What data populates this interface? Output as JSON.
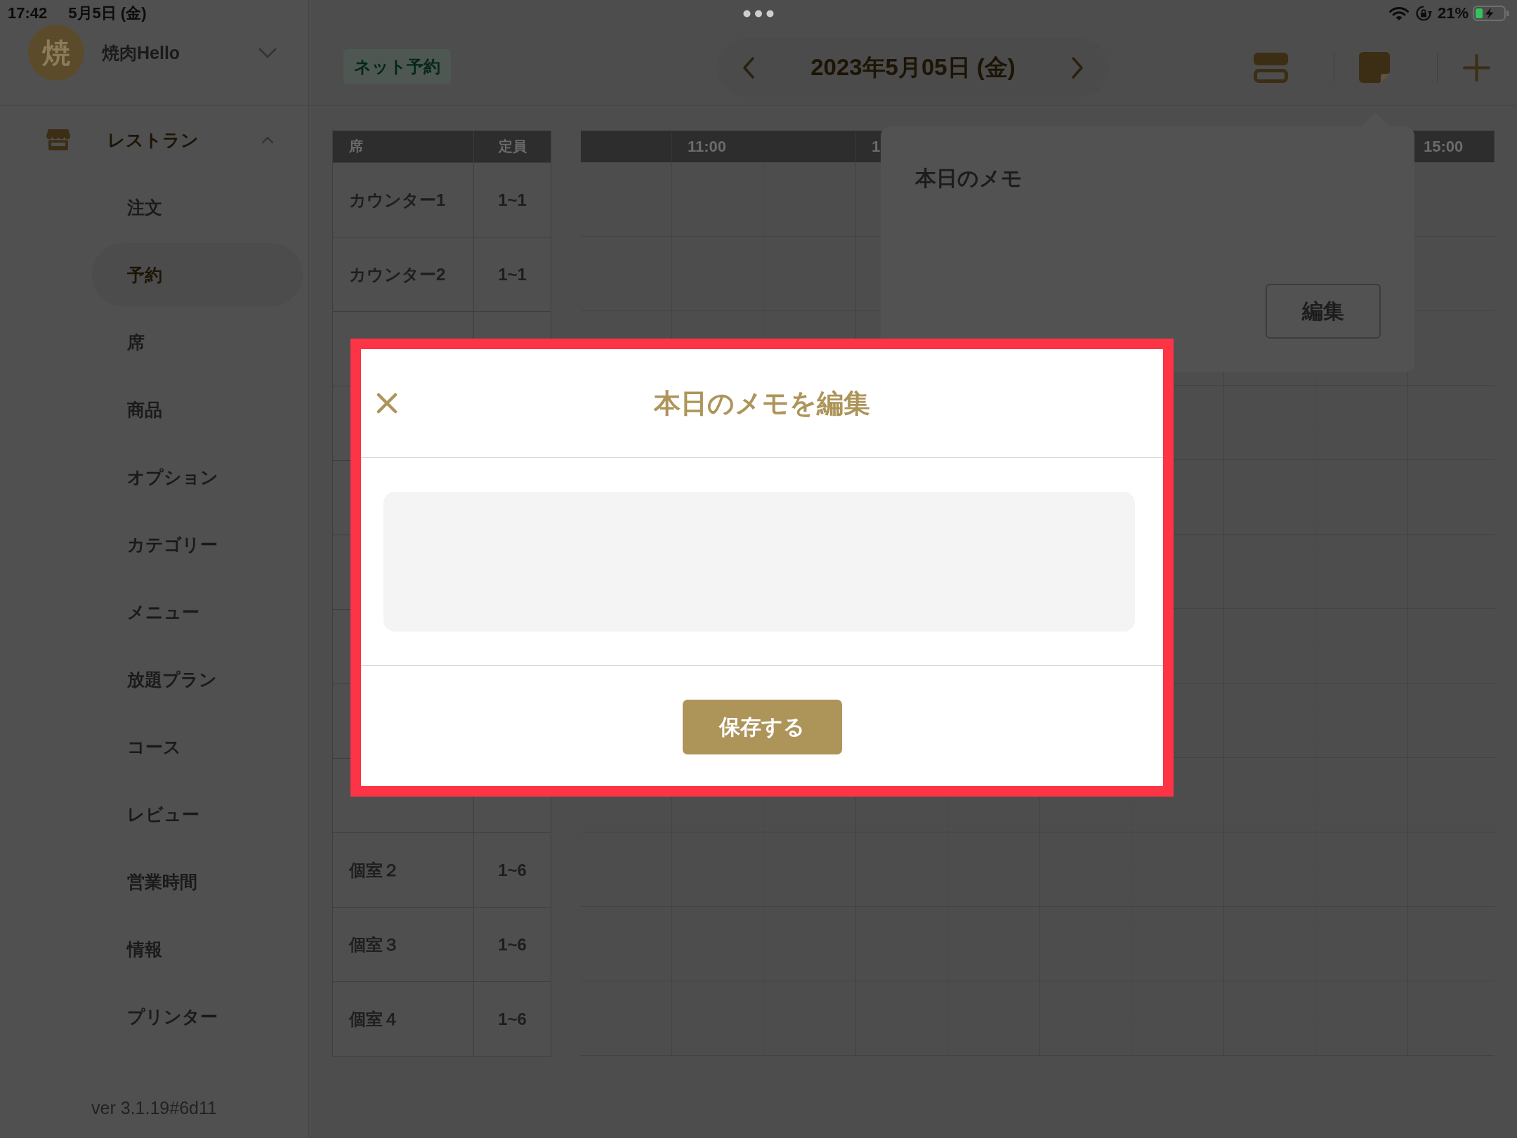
{
  "status_bar": {
    "time": "17:42",
    "date": "5月5日 (金)",
    "battery": "21%"
  },
  "sidebar": {
    "shop": {
      "avatar": "焼",
      "name": "焼肉Hello"
    },
    "section": {
      "label": "レストラン",
      "expanded": true
    },
    "items": [
      {
        "label": "注文",
        "selected": false
      },
      {
        "label": "予約",
        "selected": true
      },
      {
        "label": "席",
        "selected": false
      },
      {
        "label": "商品",
        "selected": false
      },
      {
        "label": "オプション",
        "selected": false
      },
      {
        "label": "カテゴリー",
        "selected": false
      },
      {
        "label": "メニュー",
        "selected": false
      },
      {
        "label": "放題プラン",
        "selected": false
      },
      {
        "label": "コース",
        "selected": false
      },
      {
        "label": "レビュー",
        "selected": false
      },
      {
        "label": "営業時間",
        "selected": false
      },
      {
        "label": "情報",
        "selected": false
      },
      {
        "label": "プリンター",
        "selected": false
      }
    ],
    "version": "ver 3.1.19#6d11"
  },
  "toolbar": {
    "badge": "ネット予約",
    "date": "2023年5月05日 (金)"
  },
  "seat_table": {
    "columns": [
      "席",
      "定員"
    ],
    "rows": [
      {
        "seat": "カウンター1",
        "capacity": "1~1"
      },
      {
        "seat": "カウンター2",
        "capacity": "1~1"
      },
      {},
      {},
      {},
      {},
      {},
      {},
      {},
      {
        "seat": "個室２",
        "capacity": "1~6"
      },
      {
        "seat": "個室３",
        "capacity": "1~6"
      },
      {
        "seat": "個室４",
        "capacity": "1~6"
      }
    ]
  },
  "time_grid": {
    "columns": [
      {},
      {
        "label": "11:00"
      },
      {
        "label": "1"
      },
      {},
      {},
      {
        "label": "15:00"
      }
    ]
  },
  "memo_popover": {
    "title": "本日のメモ",
    "edit_button": "編集"
  },
  "dialog": {
    "title": "本日のメモを編集",
    "save_button": "保存する"
  }
}
